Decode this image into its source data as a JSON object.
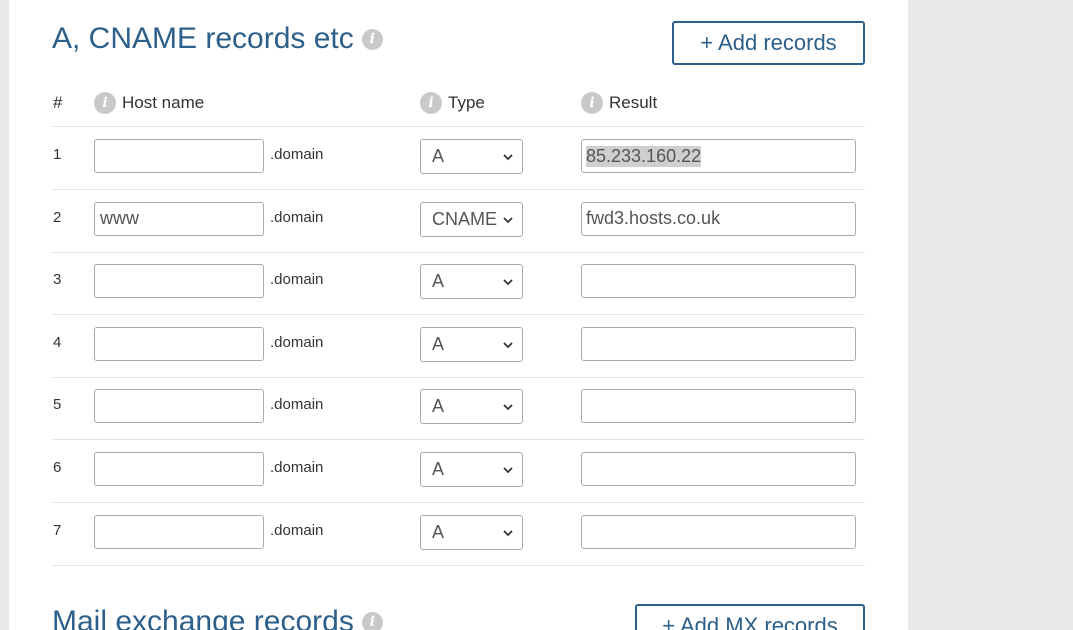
{
  "a_records": {
    "title": "A, CNAME records etc",
    "add_button_label": "+ Add records",
    "info_glyph": "i",
    "headers": {
      "num": "#",
      "host": "Host name",
      "type": "Type",
      "result": "Result"
    },
    "domain_suffix": ".domain",
    "rows": [
      {
        "num": "1",
        "host": "",
        "type": "A",
        "result": "85.233.160.22"
      },
      {
        "num": "2",
        "host": "www",
        "type": "CNAME",
        "result": "fwd3.hosts.co.uk"
      },
      {
        "num": "3",
        "host": "",
        "type": "A",
        "result": ""
      },
      {
        "num": "4",
        "host": "",
        "type": "A",
        "result": ""
      },
      {
        "num": "5",
        "host": "",
        "type": "A",
        "result": ""
      },
      {
        "num": "6",
        "host": "",
        "type": "A",
        "result": ""
      },
      {
        "num": "7",
        "host": "",
        "type": "A",
        "result": ""
      }
    ]
  },
  "mx_records": {
    "title": "Mail exchange records",
    "add_button_label": "+ Add MX records"
  },
  "colors": {
    "accent": "#2c5f8a",
    "page_background": "#e8e8e8",
    "info_icon": "#c9c9c9"
  }
}
